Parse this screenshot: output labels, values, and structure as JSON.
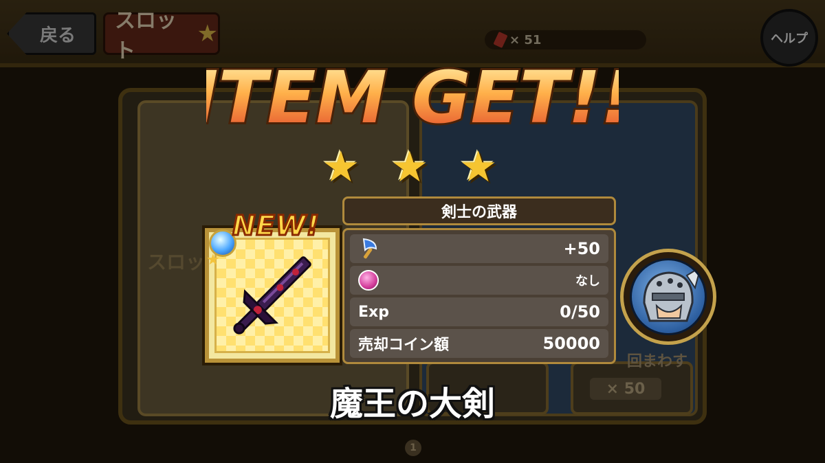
{
  "topbar": {
    "back_label": "戻る",
    "screen_title": "スロット",
    "ticket_count": "× 51",
    "help_label": "ヘルプ"
  },
  "background": {
    "left_panel_label": "スロッ",
    "spin_label": "回まわす",
    "spin_cost": "× 50",
    "page_number": "1"
  },
  "popup": {
    "title": "ITEM GET!!",
    "rarity_stars": 3,
    "new_badge": "NEW!",
    "item_category": "剣士の武器",
    "stats": [
      {
        "icon": "axe-icon",
        "label": "",
        "value": "+50"
      },
      {
        "icon": "shoe-icon",
        "label": "",
        "value": "なし"
      },
      {
        "icon": "",
        "label": "Exp",
        "value": "0/50"
      },
      {
        "icon": "",
        "label": "売却コイン額",
        "value": "50000"
      }
    ],
    "item_name": "魔王の大剣"
  },
  "colors": {
    "title_fill_top": "#ffe08a",
    "title_fill_bottom": "#e24f2a",
    "star": "#f6c531",
    "frame_gold": "#b99238",
    "new_badge": "#ffd84a"
  }
}
